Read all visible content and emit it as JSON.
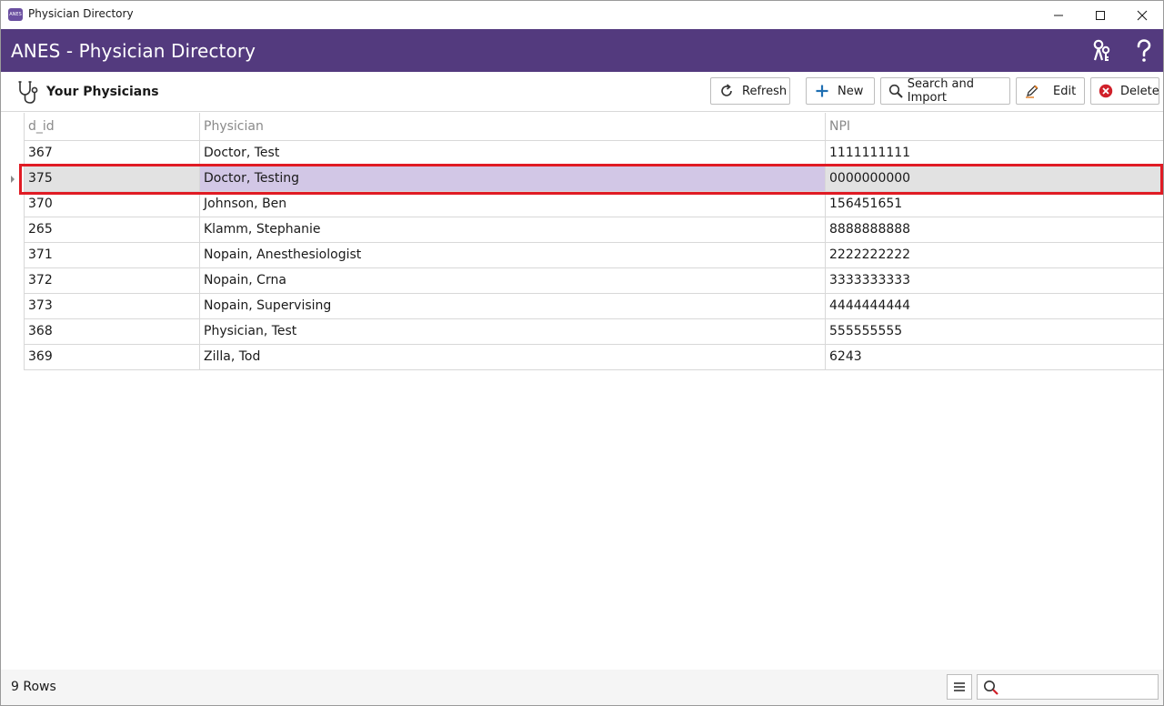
{
  "window": {
    "title": "Physician Directory",
    "app_icon_text": "ANES",
    "controls": [
      "minimize-icon",
      "maximize-icon",
      "close-icon"
    ]
  },
  "header": {
    "title": "ANES - Physician Directory",
    "icons": [
      "users-key-icon",
      "help-icon"
    ],
    "color": "#533a7e"
  },
  "toolbar": {
    "section_title": "Your Physicians",
    "section_icon": "stethoscope-icon",
    "buttons": {
      "refresh": "Refresh",
      "new": "New",
      "search_import": "Search and Import",
      "edit": "Edit",
      "delete": "Delete"
    }
  },
  "grid": {
    "columns": [
      "d_id",
      "Physician",
      "NPI"
    ],
    "rows": [
      {
        "d_id": "367",
        "physician": "Doctor, Test",
        "npi": "1111111111"
      },
      {
        "d_id": "375",
        "physician": "Doctor, Testing",
        "npi": "0000000000"
      },
      {
        "d_id": "370",
        "physician": "Johnson, Ben",
        "npi": "156451651"
      },
      {
        "d_id": "265",
        "physician": "Klamm, Stephanie",
        "npi": "8888888888"
      },
      {
        "d_id": "371",
        "physician": "Nopain, Anesthesiologist",
        "npi": "2222222222"
      },
      {
        "d_id": "372",
        "physician": "Nopain, Crna",
        "npi": "3333333333"
      },
      {
        "d_id": "373",
        "physician": "Nopain, Supervising",
        "npi": "4444444444"
      },
      {
        "d_id": "368",
        "physician": "Physician, Test",
        "npi": "555555555"
      },
      {
        "d_id": "369",
        "physician": "Zilla, Tod",
        "npi": "6243"
      }
    ],
    "selected_row": 1,
    "highlight_color": "#e01b24"
  },
  "status": {
    "rows_label": "9 Rows",
    "search_placeholder": ""
  }
}
